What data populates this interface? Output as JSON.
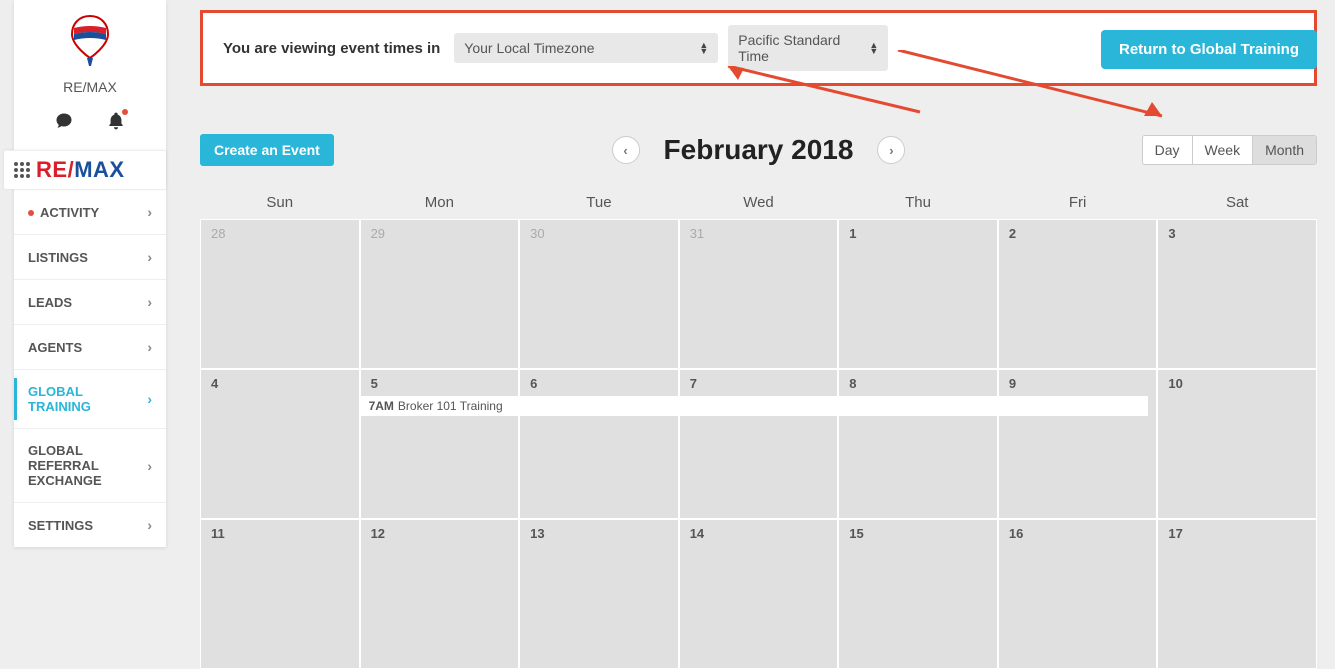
{
  "brand": {
    "name": "RE/MAX",
    "wordmark_re": "RE",
    "wordmark_slash": "/",
    "wordmark_max": "MAX"
  },
  "nav": {
    "items": [
      {
        "label": "ACTIVITY"
      },
      {
        "label": "LISTINGS"
      },
      {
        "label": "LEADS"
      },
      {
        "label": "AGENTS"
      },
      {
        "label": "GLOBAL TRAINING"
      },
      {
        "label": "GLOBAL REFERRAL EXCHANGE"
      },
      {
        "label": "SETTINGS"
      }
    ]
  },
  "topbar": {
    "text": "You are viewing event times in",
    "tz_select1": "Your Local Timezone",
    "tz_select2": "Pacific Standard Time",
    "return_btn": "Return to Global Training"
  },
  "toolbar": {
    "create": "Create an Event",
    "title": "February 2018",
    "views": {
      "day": "Day",
      "week": "Week",
      "month": "Month"
    }
  },
  "calendar": {
    "dow": [
      "Sun",
      "Mon",
      "Tue",
      "Wed",
      "Thu",
      "Fri",
      "Sat"
    ],
    "cells": [
      {
        "n": "28",
        "other": true
      },
      {
        "n": "29",
        "other": true
      },
      {
        "n": "30",
        "other": true
      },
      {
        "n": "31",
        "other": true
      },
      {
        "n": "1"
      },
      {
        "n": "2"
      },
      {
        "n": "3"
      },
      {
        "n": "4"
      },
      {
        "n": "5"
      },
      {
        "n": "6"
      },
      {
        "n": "7"
      },
      {
        "n": "8"
      },
      {
        "n": "9"
      },
      {
        "n": "10"
      },
      {
        "n": "11"
      },
      {
        "n": "12"
      },
      {
        "n": "13"
      },
      {
        "n": "14"
      },
      {
        "n": "15"
      },
      {
        "n": "16"
      },
      {
        "n": "17"
      }
    ],
    "event": {
      "time": "7AM",
      "title": "Broker 101 Training"
    }
  }
}
